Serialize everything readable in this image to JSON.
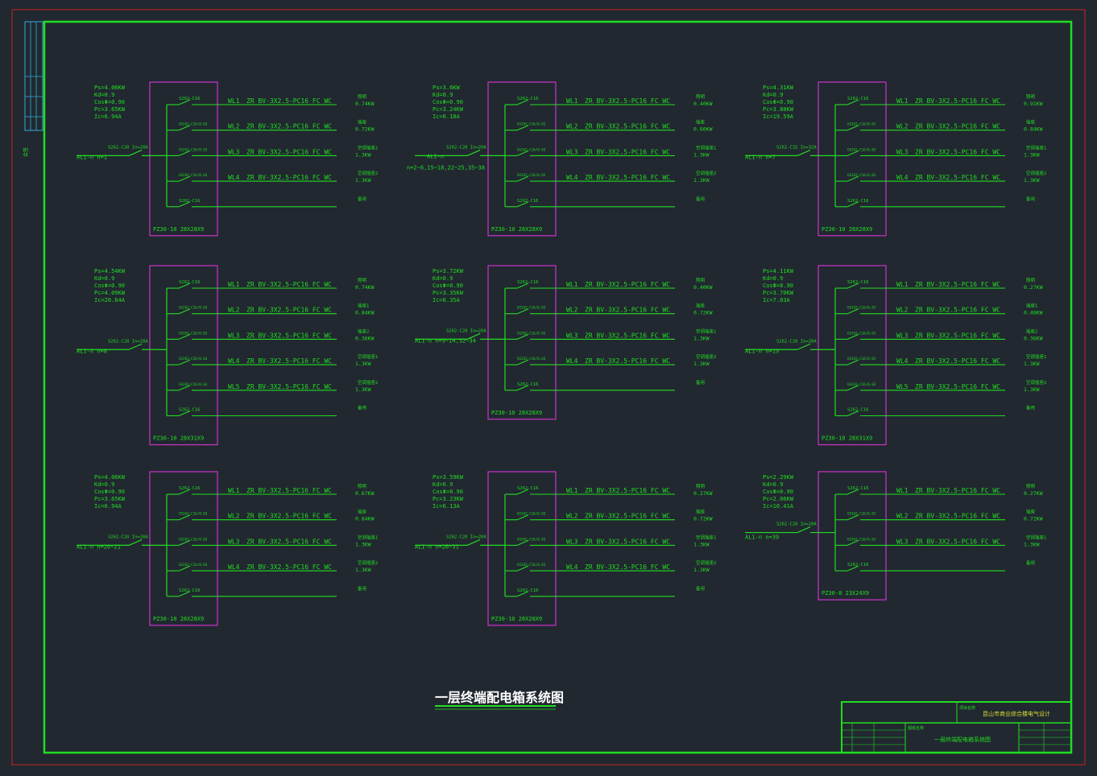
{
  "colors": {
    "background": "#212830",
    "outer_border": "#cc2222",
    "frame": "#22dd22",
    "panel_box": "#cc33cc",
    "wire": "#22dd22",
    "text": "#22dd22",
    "title_text": "#ffffff",
    "strip": "#33aadd"
  },
  "drawing_title": "一层终端配电箱系统图",
  "side_strip_label": "会签",
  "title_block": {
    "project_header": "项目名称",
    "project_name": "昆山市商业综合楼电气设计",
    "drawing_header": "图纸名称",
    "drawing_name": "一层终端配电箱系统图"
  },
  "panels": [
    {
      "stats": [
        "Ps=4.06KW",
        "Kd=0.9",
        "CosΦ=0.90",
        "Pc=3.65KW",
        "Ic=6.94A"
      ],
      "name": "AL1-n  n=1",
      "main_breaker": "S262-C20 In=20A",
      "box_label": "PZ30-10 28X28X9",
      "circuits": [
        {
          "breaker": "S262-C16",
          "wl": "WL1",
          "cable": "ZR BV-3X2.5-PC16 FC WC",
          "use": "照明",
          "load": "0.74KW"
        },
        {
          "breaker": "GS262-C16/0.03",
          "wl": "WL2",
          "cable": "ZR BV-3X2.5-PC16 FC WC",
          "use": "插座",
          "load": "0.72KW"
        },
        {
          "breaker": "GS262-C16/0.03",
          "wl": "WL3",
          "cable": "ZR BV-3X2.5-PC16 FC WC",
          "use": "空调插座1",
          "load": "1.3KW"
        },
        {
          "breaker": "GS262-C16/0.03",
          "wl": "WL4",
          "cable": "ZR BV-3X2.5-PC16 FC WC",
          "use": "空调插座2",
          "load": "1.3KW"
        },
        {
          "breaker": "S262-C16",
          "wl": "",
          "cable": "",
          "use": "备用",
          "load": ""
        }
      ]
    },
    {
      "stats": [
        "Ps=3.6KW",
        "Kd=0.9",
        "CosΦ=0.90",
        "Pc=3.24KW",
        "Ic=6.18A"
      ],
      "name": "AL1-n",
      "name2": "n=2~6,15~18,22~25,35~38",
      "main_breaker": "S262-C20 In=20A",
      "box_label": "PZ30-10 28X28X9",
      "circuits": [
        {
          "breaker": "S262-C16",
          "wl": "WL1",
          "cable": "ZR BV-3X2.5-PC16 FC WC",
          "use": "照明",
          "load": "0.40KW"
        },
        {
          "breaker": "GS262-C16/0.03",
          "wl": "WL2",
          "cable": "ZR BV-3X2.5-PC16 FC WC",
          "use": "插座",
          "load": "0.60KW"
        },
        {
          "breaker": "GS262-C16/0.03",
          "wl": "WL3",
          "cable": "ZR BV-3X2.5-PC16 FC WC",
          "use": "空调插座1",
          "load": "1.3KW"
        },
        {
          "breaker": "GS262-C16/0.03",
          "wl": "WL4",
          "cable": "ZR BV-3X2.5-PC16 FC WC",
          "use": "空调插座2",
          "load": "1.3KW"
        },
        {
          "breaker": "S262-C16",
          "wl": "",
          "cable": "",
          "use": "备用",
          "load": ""
        }
      ]
    },
    {
      "stats": [
        "Ps=4.31KW",
        "Kd=0.9",
        "CosΦ=0.90",
        "Pc=3.88KW",
        "Ic=19.59A"
      ],
      "name": "AL1-n  n=7",
      "main_breaker": "S262-C32 In=32A",
      "box_label": "PZ30-10 28X28X9",
      "circuits": [
        {
          "breaker": "S262-C16",
          "wl": "WL1",
          "cable": "ZR BV-3X2.5-PC16 FC WC",
          "use": "照明",
          "load": "0.91KW"
        },
        {
          "breaker": "GS262-C16/0.03",
          "wl": "WL2",
          "cable": "ZR BV-3X2.5-PC16 FC WC",
          "use": "插座",
          "load": "0.84KW"
        },
        {
          "breaker": "GS262-C16/0.03",
          "wl": "WL3",
          "cable": "ZR BV-3X2.5-PC16 FC WC",
          "use": "空调插座1",
          "load": "1.3KW"
        },
        {
          "breaker": "GS262-C16/0.03",
          "wl": "WL4",
          "cable": "ZR BV-3X2.5-PC16 FC WC",
          "use": "空调插座2",
          "load": "1.3KW"
        },
        {
          "breaker": "S262-C16",
          "wl": "",
          "cable": "",
          "use": "备用",
          "load": ""
        }
      ]
    },
    {
      "stats": [
        "Ps=4.54KW",
        "Kd=0.9",
        "CosΦ=0.90",
        "Pc=4.09KW",
        "Ic=20.64A"
      ],
      "name": "AL1-n  n=8",
      "main_breaker": "S262-C20 In=20A",
      "box_label": "PZ30-10 28X31X9",
      "circuits": [
        {
          "breaker": "S262-C16",
          "wl": "WL1",
          "cable": "ZR BV-3X2.5-PC16 FC WC",
          "use": "照明",
          "load": "0.74KW"
        },
        {
          "breaker": "GS262-C16/0.03",
          "wl": "WL2",
          "cable": "ZR BV-3X2.5-PC16 FC WC",
          "use": "插座1",
          "load": "0.84KW"
        },
        {
          "breaker": "GS262-C16/0.03",
          "wl": "WL3",
          "cable": "ZR BV-3X2.5-PC16 FC WC",
          "use": "插座2",
          "load": "0.36KW"
        },
        {
          "breaker": "GS262-C16/0.03",
          "wl": "WL4",
          "cable": "ZR BV-3X2.5-PC16 FC WC",
          "use": "空调插座1",
          "load": "1.3KW"
        },
        {
          "breaker": "GS262-C16/0.03",
          "wl": "WL5",
          "cable": "ZR BV-3X2.5-PC16 FC WC",
          "use": "空调插座2",
          "load": "1.3KW"
        },
        {
          "breaker": "S262-C16",
          "wl": "",
          "cable": "",
          "use": "备用",
          "load": ""
        }
      ]
    },
    {
      "stats": [
        "Ps=3.72KW",
        "Kd=0.9",
        "CosΦ=0.90",
        "Pc=3.35KW",
        "Ic=6.35A"
      ],
      "name": "AL1-n  n=9~14,32~34",
      "main_breaker": "S262-C20 In=20A",
      "box_label": "PZ30-10 28X28X9",
      "circuits": [
        {
          "breaker": "S262-C16",
          "wl": "WL1",
          "cable": "ZR BV-3X2.5-PC16 FC WC",
          "use": "照明",
          "load": "0.40KW"
        },
        {
          "breaker": "GS262-C16/0.03",
          "wl": "WL2",
          "cable": "ZR BV-3X2.5-PC16 FC WC",
          "use": "插座",
          "load": "0.72KW"
        },
        {
          "breaker": "GS262-C16/0.03",
          "wl": "WL3",
          "cable": "ZR BV-3X2.5-PC16 FC WC",
          "use": "空调插座1",
          "load": "1.3KW"
        },
        {
          "breaker": "GS262-C16/0.03",
          "wl": "WL4",
          "cable": "ZR BV-3X2.5-PC16 FC WC",
          "use": "空调插座2",
          "load": "1.3KW"
        },
        {
          "breaker": "S262-C16",
          "wl": "",
          "cable": "",
          "use": "备用",
          "load": ""
        }
      ]
    },
    {
      "stats": [
        "Ps=4.11KW",
        "Kd=0.9",
        "CosΦ=0.90",
        "Pc=3.70KW",
        "Ic=7.03A"
      ],
      "name": "AL1-n  n=19",
      "main_breaker": "S262-C20 In=20A",
      "box_label": "PZ30-10 28X31X9",
      "circuits": [
        {
          "breaker": "S262-C16",
          "wl": "WL1",
          "cable": "ZR BV-3X2.5-PC16 FC WC",
          "use": "照明",
          "load": "0.27KW"
        },
        {
          "breaker": "GS262-C16/0.03",
          "wl": "WL2",
          "cable": "ZR BV-3X2.5-PC16 FC WC",
          "use": "插座1",
          "load": "0.48KW"
        },
        {
          "breaker": "GS262-C16/0.03",
          "wl": "WL3",
          "cable": "ZR BV-3X2.5-PC16 FC WC",
          "use": "插座2",
          "load": "0.36KW"
        },
        {
          "breaker": "GS262-C16/0.03",
          "wl": "WL4",
          "cable": "ZR BV-3X2.5-PC16 FC WC",
          "use": "空调插座1",
          "load": "1.3KW"
        },
        {
          "breaker": "GS262-C16/0.03",
          "wl": "WL5",
          "cable": "ZR BV-3X2.5-PC16 FC WC",
          "use": "空调插座2",
          "load": "1.3KW"
        },
        {
          "breaker": "S262-C16",
          "wl": "",
          "cable": "",
          "use": "备用",
          "load": ""
        }
      ]
    },
    {
      "stats": [
        "Ps=4.06KW",
        "Kd=0.9",
        "CosΦ=0.90",
        "Pc=3.65KW",
        "Ic=6.94A"
      ],
      "name": "AL1-n  n=20~21",
      "main_breaker": "S262-C20 In=20A",
      "box_label": "PZ30-10 28X28X9",
      "circuits": [
        {
          "breaker": "S262-C16",
          "wl": "WL1",
          "cable": "ZR BV-3X2.5-PC16 FC WC",
          "use": "照明",
          "load": "0.67KW"
        },
        {
          "breaker": "GS262-C16/0.03",
          "wl": "WL2",
          "cable": "ZR BV-3X2.5-PC16 FC WC",
          "use": "插座",
          "load": "0.84KW"
        },
        {
          "breaker": "GS262-C16/0.03",
          "wl": "WL3",
          "cable": "ZR BV-3X2.5-PC16 FC WC",
          "use": "空调插座1",
          "load": "1.3KW"
        },
        {
          "breaker": "GS262-C16/0.03",
          "wl": "WL4",
          "cable": "ZR BV-3X2.5-PC16 FC WC",
          "use": "空调插座2",
          "load": "1.3KW"
        },
        {
          "breaker": "S262-C16",
          "wl": "",
          "cable": "",
          "use": "备用",
          "load": ""
        }
      ]
    },
    {
      "stats": [
        "Ps=3.59KW",
        "Kd=0.9",
        "CosΦ=0.90",
        "Pc=3.23KW",
        "Ic=6.13A"
      ],
      "name": "AL1-n  n=26~31",
      "main_breaker": "S262-C20 In=20A",
      "box_label": "PZ30-10 28X28X9",
      "circuits": [
        {
          "breaker": "S262-C16",
          "wl": "WL1",
          "cable": "ZR BV-3X2.5-PC16 FC WC",
          "use": "照明",
          "load": "0.27KW"
        },
        {
          "breaker": "GS262-C16/0.03",
          "wl": "WL2",
          "cable": "ZR BV-3X2.5-PC16 FC WC",
          "use": "插座",
          "load": "0.72KW"
        },
        {
          "breaker": "GS262-C16/0.03",
          "wl": "WL3",
          "cable": "ZR BV-3X2.5-PC16 FC WC",
          "use": "空调插座1",
          "load": "1.3KW"
        },
        {
          "breaker": "GS262-C16/0.03",
          "wl": "WL4",
          "cable": "ZR BV-3X2.5-PC16 FC WC",
          "use": "空调插座2",
          "load": "1.3KW"
        },
        {
          "breaker": "S262-C16",
          "wl": "",
          "cable": "",
          "use": "备用",
          "load": ""
        }
      ]
    },
    {
      "stats": [
        "Ps=2.29KW",
        "Kd=0.9",
        "CosΦ=0.90",
        "Pc=2.06KW",
        "Ic=10.41A"
      ],
      "name": "AL1-n  n=39",
      "main_breaker": "S262-C20 In=20A",
      "box_label": "PZ30-8 23X24X9",
      "circuits": [
        {
          "breaker": "S262-C16",
          "wl": "WL1",
          "cable": "ZR BV-3X2.5-PC16 FC WC",
          "use": "照明",
          "load": "0.27KW"
        },
        {
          "breaker": "GS262-C16/0.03",
          "wl": "WL2",
          "cable": "ZR BV-3X2.5-PC16 FC WC",
          "use": "插座",
          "load": "0.72KW"
        },
        {
          "breaker": "GS262-C16/0.03",
          "wl": "WL3",
          "cable": "ZR BV-3X2.5-PC16 FC WC",
          "use": "空调插座1",
          "load": "1.3KW"
        },
        {
          "breaker": "S262-C16",
          "wl": "",
          "cable": "",
          "use": "备用",
          "load": ""
        }
      ]
    }
  ]
}
